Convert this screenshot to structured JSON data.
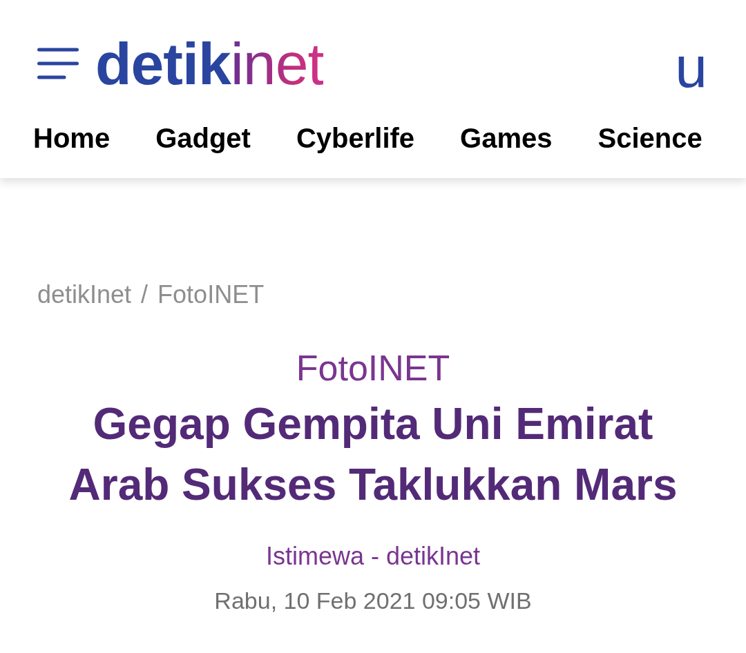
{
  "header": {
    "logo": {
      "part_1": "detik",
      "part_2": "inet"
    },
    "user_button": "u"
  },
  "nav": {
    "items": [
      {
        "label": "Home"
      },
      {
        "label": "Gadget"
      },
      {
        "label": "Cyberlife"
      },
      {
        "label": "Games"
      },
      {
        "label": "Science"
      }
    ]
  },
  "breadcrumb": [
    "detikInet",
    "FotoINET"
  ],
  "breadcrumb_separator": "/",
  "article": {
    "category": "FotoINET",
    "title": "Gegap Gempita Uni Emirat Arab Sukses Taklukkan Mars",
    "credit": "Istimewa - detikInet",
    "date": "Rabu, 10 Feb 2021 09:05 WIB"
  }
}
